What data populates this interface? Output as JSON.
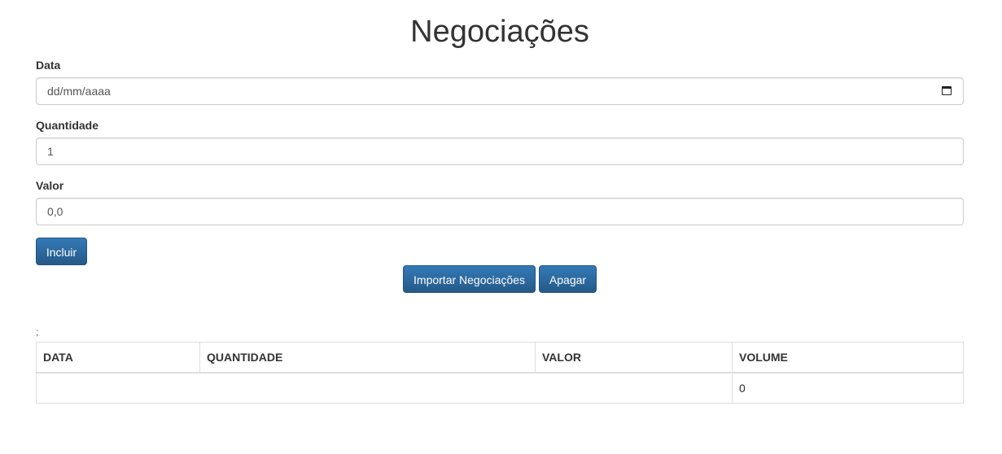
{
  "page": {
    "title": "Negociações"
  },
  "form": {
    "data": {
      "label": "Data",
      "placeholder": "dd/mm/aaaa"
    },
    "quantidade": {
      "label": "Quantidade",
      "value": "1"
    },
    "valor": {
      "label": "Valor",
      "value": "0,0"
    },
    "incluir_label": "Incluir"
  },
  "actions": {
    "importar_label": "Importar Negociações",
    "apagar_label": "Apagar"
  },
  "message": ";",
  "table": {
    "headers": [
      "DATA",
      "QUANTIDADE",
      "VALOR",
      "VOLUME"
    ],
    "footer_volume": "0"
  },
  "colors": {
    "primary": "#337ab7",
    "border": "#cccccc"
  }
}
